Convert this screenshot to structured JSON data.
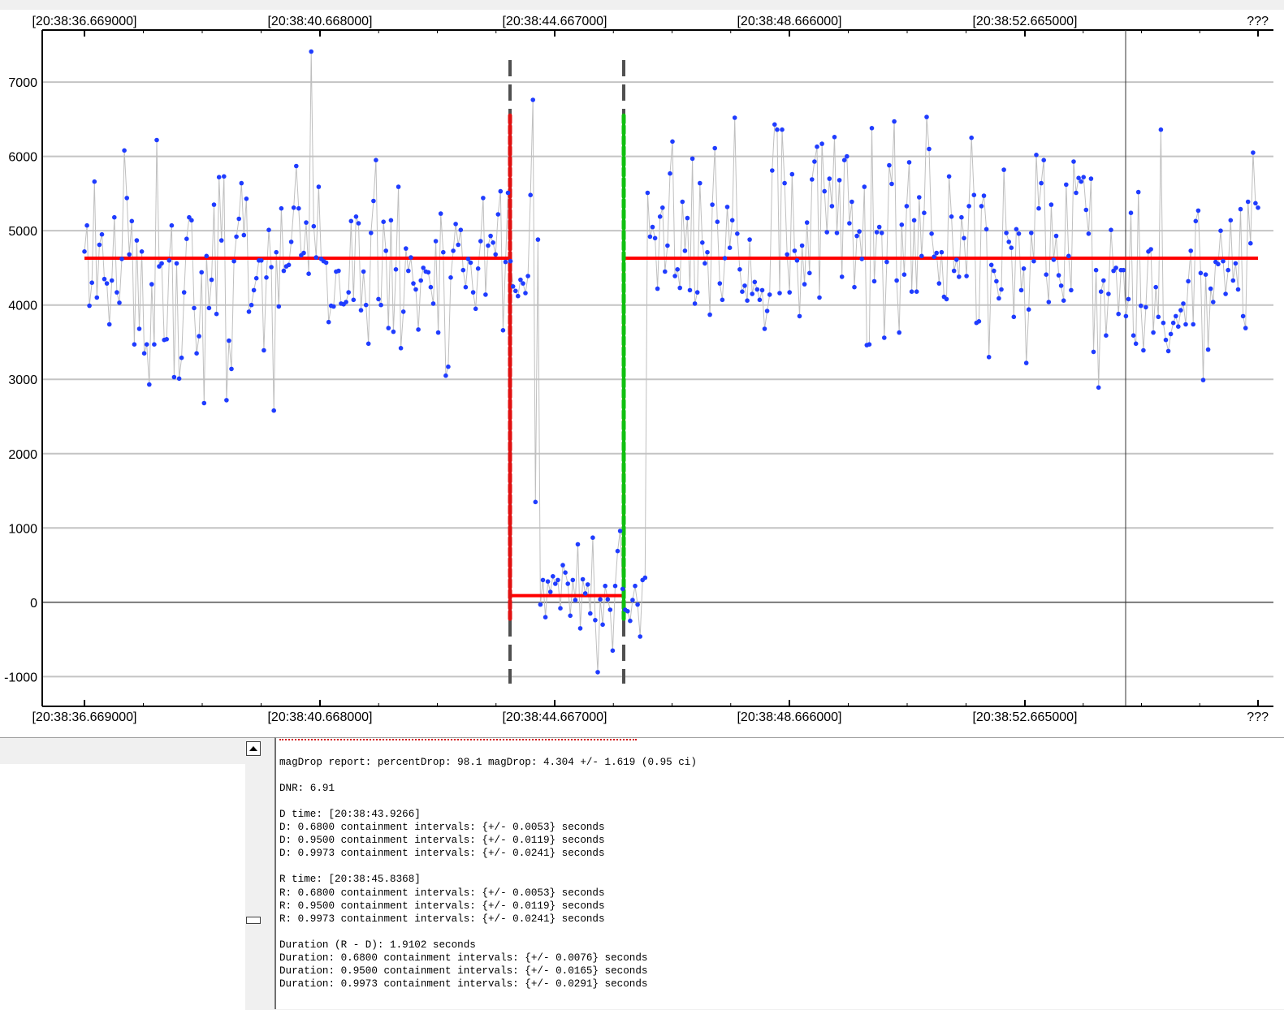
{
  "chart_data": {
    "type": "scatter",
    "title": "",
    "xlabel": "",
    "ylabel": "",
    "x_tick_labels": [
      "[20:38:36.669000]",
      "[20:38:40.668000]",
      "[20:38:44.667000]",
      "[20:38:48.666000]",
      "[20:38:52.665000]",
      "???"
    ],
    "y_tick_labels": [
      "-1000",
      "0",
      "1000",
      "2000",
      "3000",
      "4000",
      "5000",
      "6000",
      "7000"
    ],
    "y_ticks": [
      -1000,
      0,
      1000,
      2000,
      3000,
      4000,
      5000,
      6000,
      7000
    ],
    "ylim": [
      -1400,
      7700
    ],
    "grid": true,
    "series": [
      {
        "kind": "points",
        "color": "#1f3cff",
        "y": [
          4720,
          5070,
          3990,
          4300,
          5660,
          4100,
          4810,
          4950,
          4350,
          4290,
          3740,
          4330,
          5180,
          4170,
          4030,
          4620,
          6080,
          5440,
          4680,
          5130,
          3470,
          4870,
          3680,
          4720,
          3350,
          3470,
          2930,
          4280,
          3470,
          6220,
          4520,
          4560,
          3530,
          3540,
          4600,
          5070,
          3030,
          4560,
          3010,
          3290,
          4170,
          4890,
          5180,
          5140,
          3960,
          3350,
          3580,
          4440,
          2680,
          4660,
          3960,
          4340,
          5350,
          3880,
          5720,
          4870,
          5730,
          2720,
          3520,
          3140,
          4590,
          4920,
          5160,
          5640,
          4940,
          5430,
          3910,
          4000,
          4200,
          4360,
          4600,
          4600,
          3390,
          4370,
          5010,
          4510,
          2580,
          4710,
          3980,
          5300,
          4460,
          4520,
          4540,
          4850,
          5310,
          5870,
          5300,
          4670,
          4700,
          5110,
          4420,
          7410,
          5060,
          4640,
          5590,
          4620,
          4590,
          4570,
          3770,
          3990,
          3980,
          4450,
          4460,
          4020,
          4010,
          4040,
          4170,
          5130,
          4070,
          5190,
          5100,
          3930,
          4450,
          4000,
          3480,
          4970,
          5400,
          5950,
          4080,
          4000,
          5120,
          4730,
          3690,
          5140,
          3640,
          4480,
          5590,
          3420,
          3910,
          4760,
          4460,
          4640,
          4290,
          4210,
          3670,
          4330,
          4500,
          4450,
          4440,
          4240,
          4020,
          4860,
          3630,
          5230,
          4710,
          3050,
          3170,
          4370,
          4730,
          5090,
          4810,
          5010,
          4470,
          4240,
          4620,
          4570,
          4170,
          3950,
          4490,
          4860,
          5440,
          4140,
          4800,
          4930,
          4840,
          4680,
          5220,
          5530,
          3660,
          4580,
          5510,
          4590,
          4250,
          4190,
          4120,
          4340,
          4290,
          4160,
          4390,
          5480,
          6760,
          1350,
          4880,
          -30,
          300,
          -200,
          280,
          140,
          350,
          250,
          300,
          -80,
          500,
          400,
          250,
          -180,
          300,
          30,
          780,
          -350,
          310,
          120,
          240,
          -150,
          870,
          -240,
          -940,
          40,
          -300,
          220,
          40,
          -100,
          -650,
          220,
          690,
          960,
          180,
          -100,
          -120,
          -250,
          30,
          220,
          -30,
          -460,
          300,
          330,
          5510,
          4920,
          5050,
          4900,
          4220,
          5190,
          5310,
          4450,
          4800,
          5770,
          6200,
          4390,
          4480,
          4230,
          5390,
          4730,
          5170,
          4200,
          5970,
          4020,
          4170,
          5640,
          4840,
          4560,
          4710,
          3870,
          5350,
          6110,
          5120,
          4290,
          4070,
          4630,
          5320,
          4770,
          5140,
          6520,
          4960,
          4480,
          4180,
          4260,
          4060,
          4880,
          4150,
          4310,
          4210,
          4070,
          4200,
          3680,
          3920,
          4140,
          5810,
          6430,
          6360,
          4160,
          6360,
          5640,
          4680,
          4170,
          5760,
          4730,
          4600,
          3850,
          4800,
          4280,
          5110,
          4430,
          5690,
          5930,
          6130,
          4100,
          6170,
          5530,
          4980,
          5700,
          5330,
          6260,
          4970,
          5680,
          4380,
          5950,
          6000,
          5100,
          5390,
          4240,
          4930,
          4990,
          4620,
          5590,
          3460,
          3470,
          6380,
          4320,
          4980,
          5050,
          4970,
          3560,
          4580,
          5880,
          5630,
          6470,
          4330,
          3630,
          5080,
          4410,
          5330,
          5920,
          4180,
          5140,
          4180,
          5450,
          4660,
          5240,
          6530,
          6100,
          4960,
          4650,
          4700,
          4290,
          4710,
          4110,
          4080,
          5730,
          5190,
          4460,
          4610,
          4380,
          5180,
          4900,
          4390,
          5330,
          6250,
          5480,
          3760,
          3780,
          5330,
          5470,
          5020,
          3300,
          4540,
          4460,
          4320,
          4090,
          4210,
          5820,
          4970,
          4850,
          4770,
          3840,
          5020,
          4960,
          4200,
          4490,
          3220,
          3940,
          4970,
          4590,
          6020,
          5300,
          5640,
          5950,
          4410,
          4040,
          5350,
          4610,
          4930,
          4400,
          4260,
          4060,
          5620,
          4660,
          4200,
          5930,
          5510,
          5710,
          5660,
          5720,
          5280,
          4960,
          5700,
          3370,
          4470,
          2890,
          4180,
          4330,
          3590,
          4150,
          5010,
          4460,
          4500,
          3880,
          4470,
          4470,
          3850,
          4080,
          5240,
          3590,
          3480,
          5520,
          3990,
          3390,
          3970,
          4720,
          4750,
          3630,
          4240,
          3840,
          6360,
          3760,
          3530,
          3380,
          3610,
          3760,
          3850,
          3710,
          3930,
          4020,
          3740,
          4320,
          4730,
          3740,
          5130,
          5270,
          4430,
          2990,
          4410,
          3400,
          4220,
          4040,
          4580,
          4550,
          5000,
          4590,
          4150,
          4470,
          5140,
          4330,
          4560,
          4210,
          5290,
          3850,
          3690,
          5390,
          4830,
          6050,
          5370,
          5310
        ],
        "x_range": [
          0,
          1
        ]
      },
      {
        "kind": "step-fit",
        "color": "#ff0000",
        "levels": [
          4630,
          90,
          4630
        ]
      }
    ],
    "markers": {
      "d_dashed_color": "#e01010",
      "r_dashed_color": "#10c010",
      "bracket_color": "#505050"
    }
  },
  "log": {
    "lines": [
      "magDrop report: percentDrop: 98.1 magDrop: 4.304 +/- 1.619 (0.95 ci)",
      "",
      "DNR: 6.91",
      "",
      "D time: [20:38:43.9266]",
      "D: 0.6800 containment intervals: {+/- 0.0053} seconds",
      "D: 0.9500 containment intervals: {+/- 0.0119} seconds",
      "D: 0.9973 containment intervals: {+/- 0.0241} seconds",
      "",
      "R time: [20:38:45.8368]",
      "R: 0.6800 containment intervals: {+/- 0.0053} seconds",
      "R: 0.9500 containment intervals: {+/- 0.0119} seconds",
      "R: 0.9973 containment intervals: {+/- 0.0241} seconds",
      "",
      "Duration (R - D): 1.9102 seconds",
      "Duration: 0.6800 containment intervals: {+/- 0.0076} seconds",
      "Duration: 0.9500 containment intervals: {+/- 0.0165} seconds",
      "Duration: 0.9973 containment intervals: {+/- 0.0291} seconds"
    ]
  }
}
